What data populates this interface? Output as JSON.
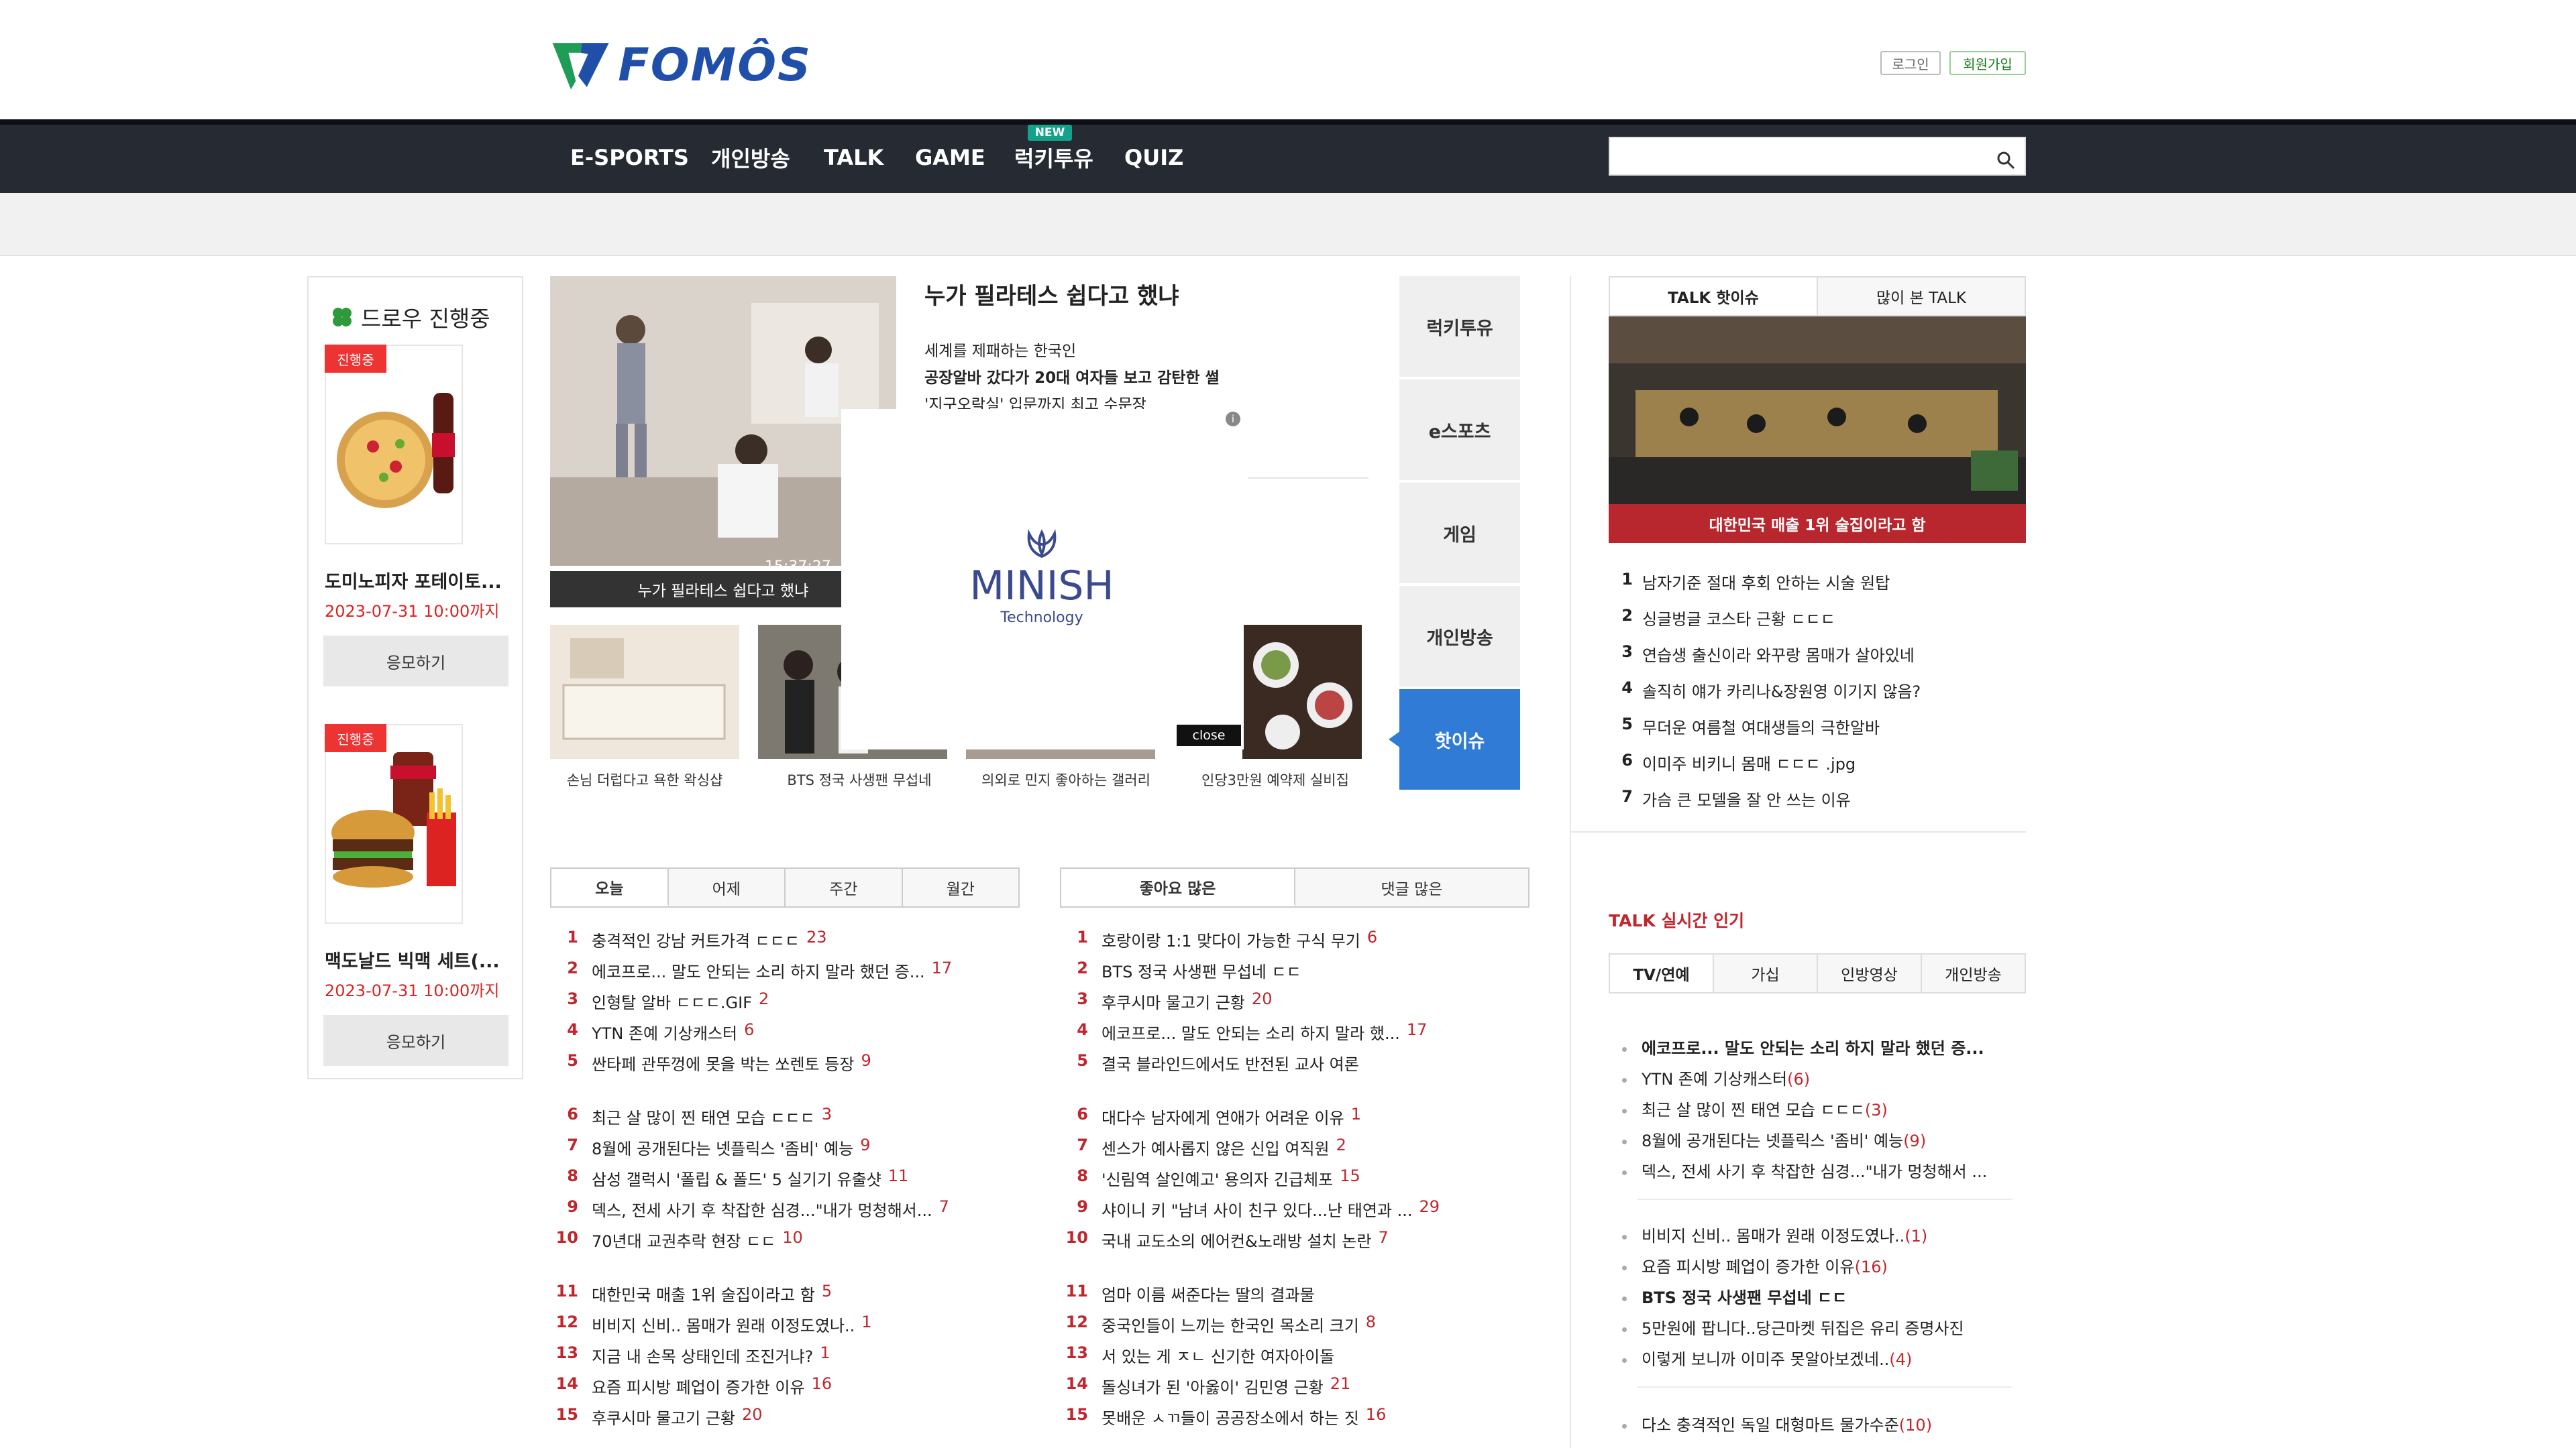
{
  "header": {
    "logo_text": "FOMÔS",
    "login": "로그인",
    "signup": "회원가입",
    "brand_color": "#1f4fa8"
  },
  "nav": {
    "items": [
      "E-SPORTS",
      "개인방송",
      "TALK",
      "GAME",
      "럭키투유",
      "QUIZ"
    ],
    "new_badge": "NEW",
    "search_placeholder": ""
  },
  "draw": {
    "title": "드로우 진행중",
    "items": [
      {
        "status": "진행중",
        "name": "도미노피자 포테이토...",
        "date": "2023-07-31 10:00까지",
        "button": "응모하기"
      },
      {
        "status": "진행중",
        "name": "맥도날드 빅맥 세트(...",
        "date": "2023-07-31 10:00까지",
        "button": "응모하기"
      }
    ]
  },
  "featured": {
    "title": "누가 필라테스 쉽다고 했냐",
    "caption": "누가 필라테스 쉽다고 했냐",
    "timestamp": "15:37:27",
    "lines": [
      "세계를 제패하는 한국인",
      "공장알바 갔다가 20대 여자들 보고 감탄한 썰",
      "'지구오락실' 입문까지 최고 수문장"
    ],
    "thumbs": [
      "손님 더럽다고 욕한 왁싱샵",
      "BTS 정국 사생팬 무섭네",
      "의외로 민지 좋아하는 갤러리",
      "인당3만원 예약제 실비집"
    ]
  },
  "ad": {
    "brand": "MINISH",
    "sub": "Technology",
    "close": "close",
    "info": "i"
  },
  "side_tabs": [
    "럭키투유",
    "e스포츠",
    "게임",
    "개인방송",
    "핫이슈"
  ],
  "talk": {
    "tabs": [
      "TALK 핫이슈",
      "많이 본 TALK"
    ],
    "image_caption": "대한민국 매출 1위 술집이라고 함",
    "hot": [
      {
        "n": "1",
        "t": "남자기준 절대 후회 안하는 시술 원탑"
      },
      {
        "n": "2",
        "t": "싱글벙글 코스타 근황 ㄷㄷㄷ"
      },
      {
        "n": "3",
        "t": "연습생 출신이라 와꾸랑 몸매가 살아있네"
      },
      {
        "n": "4",
        "t": "솔직히 얘가 카리나&장원영 이기지 않음?"
      },
      {
        "n": "5",
        "t": "무더운 여름철 여대생들의 극한알바"
      },
      {
        "n": "6",
        "t": "이미주 비키니 몸매 ㄷㄷㄷ .jpg"
      },
      {
        "n": "7",
        "t": "가슴 큰 모델을 잘 안 쓰는 이유"
      }
    ]
  },
  "live": {
    "title": "TALK 실시간 인기",
    "tabs": [
      "TV/연예",
      "가십",
      "인방영상",
      "개인방송"
    ],
    "groups": [
      [
        {
          "t": "에코프로... 말도 안되는 소리 하지 말라 했던 증...",
          "c": "",
          "bold": true
        },
        {
          "t": "YTN 존예 기상캐스터",
          "c": "(6)"
        },
        {
          "t": "최근 살 많이 찐 태연 모습 ㄷㄷㄷ",
          "c": "(3)"
        },
        {
          "t": "8월에 공개된다는 넷플릭스 '좀비' 예능",
          "c": "(9)"
        },
        {
          "t": "덱스, 전세 사기 후 착잡한 심경...\"내가 멍청해서 ...",
          "c": ""
        }
      ],
      [
        {
          "t": "비비지 신비.. 몸매가 원래 이정도였나..",
          "c": "(1)"
        },
        {
          "t": "요즘 피시방 폐업이 증가한 이유",
          "c": "(16)"
        },
        {
          "t": "BTS 정국 사생팬 무섭네 ㄷㄷ",
          "c": "",
          "bold": true
        },
        {
          "t": "5만원에 팝니다..당근마켓 뒤집은 유리 증명사진",
          "c": ""
        },
        {
          "t": "이렇게 보니까 이미주 못알아보겠네..",
          "c": "(4)"
        }
      ],
      [
        {
          "t": "다소 충격적인 독일 대형마트 물가수준",
          "c": "(10)"
        }
      ]
    ]
  },
  "rank_left": {
    "tabs": [
      "오늘",
      "어제",
      "주간",
      "월간"
    ],
    "rows": [
      {
        "n": "1",
        "t": "충격적인 강남 커트가격 ㄷㄷㄷ",
        "c": "23"
      },
      {
        "n": "2",
        "t": "에코프로... 말도 안되는 소리 하지 말라 했던 증...",
        "c": "17"
      },
      {
        "n": "3",
        "t": "인형탈 알바 ㄷㄷㄷ.GIF",
        "c": "2"
      },
      {
        "n": "4",
        "t": "YTN 존예 기상캐스터",
        "c": "6"
      },
      {
        "n": "5",
        "t": "싼타페 관뚜껑에 못을 박는 쏘렌토 등장",
        "c": "9"
      },
      {
        "n": "6",
        "t": "최근 살 많이 찐 태연 모습 ㄷㄷㄷ",
        "c": "3"
      },
      {
        "n": "7",
        "t": "8월에 공개된다는 넷플릭스 '좀비' 예능",
        "c": "9"
      },
      {
        "n": "8",
        "t": "삼성 갤럭시 '폴립 & 폴드' 5 실기기 유출샷",
        "c": "11"
      },
      {
        "n": "9",
        "t": "덱스, 전세 사기 후 착잡한 심경...\"내가 멍청해서...",
        "c": "7"
      },
      {
        "n": "10",
        "t": "70년대 교권추락 현장 ㄷㄷ",
        "c": "10"
      },
      {
        "n": "11",
        "t": "대한민국 매출 1위 술집이라고 함",
        "c": "5"
      },
      {
        "n": "12",
        "t": "비비지 신비.. 몸매가 원래 이정도였나..",
        "c": "1"
      },
      {
        "n": "13",
        "t": "지금 내 손목 상태인데 조진거냐?",
        "c": "1"
      },
      {
        "n": "14",
        "t": "요즘 피시방 폐업이 증가한 이유",
        "c": "16"
      },
      {
        "n": "15",
        "t": "후쿠시마 물고기 근황",
        "c": "20"
      }
    ]
  },
  "rank_right": {
    "tabs": [
      "좋아요 많은",
      "댓글 많은"
    ],
    "rows": [
      {
        "n": "1",
        "t": "호랑이랑 1:1 맞다이 가능한 구식 무기",
        "c": "6"
      },
      {
        "n": "2",
        "t": "BTS 정국 사생팬 무섭네 ㄷㄷ",
        "c": ""
      },
      {
        "n": "3",
        "t": "후쿠시마 물고기 근황",
        "c": "20"
      },
      {
        "n": "4",
        "t": "에코프로... 말도 안되는 소리 하지 말라 했...",
        "c": "17"
      },
      {
        "n": "5",
        "t": "결국 블라인드에서도 반전된 교사 여론",
        "c": ""
      },
      {
        "n": "6",
        "t": "대다수 남자에게 연애가 어려운 이유",
        "c": "1"
      },
      {
        "n": "7",
        "t": "센스가 예사롭지 않은 신입 여직원",
        "c": "2"
      },
      {
        "n": "8",
        "t": "'신림역 살인예고' 용의자 긴급체포",
        "c": "15"
      },
      {
        "n": "9",
        "t": "샤이니 키 \"남녀 사이 친구 있다...난 태연과 ...",
        "c": "29"
      },
      {
        "n": "10",
        "t": "국내 교도소의 에어컨&노래방 설치 논란",
        "c": "7"
      },
      {
        "n": "11",
        "t": "엄마 이름 써준다는 딸의 결과물",
        "c": ""
      },
      {
        "n": "12",
        "t": "중국인들이 느끼는 한국인 목소리 크기",
        "c": "8"
      },
      {
        "n": "13",
        "t": "서 있는 게 ㅈㄴ 신기한 여자아이돌",
        "c": ""
      },
      {
        "n": "14",
        "t": "돌싱녀가 된 '아옳이' 김민영 근황",
        "c": "21"
      },
      {
        "n": "15",
        "t": "못배운 ㅅㄲ들이 공공장소에서 하는 짓",
        "c": "16"
      }
    ]
  }
}
